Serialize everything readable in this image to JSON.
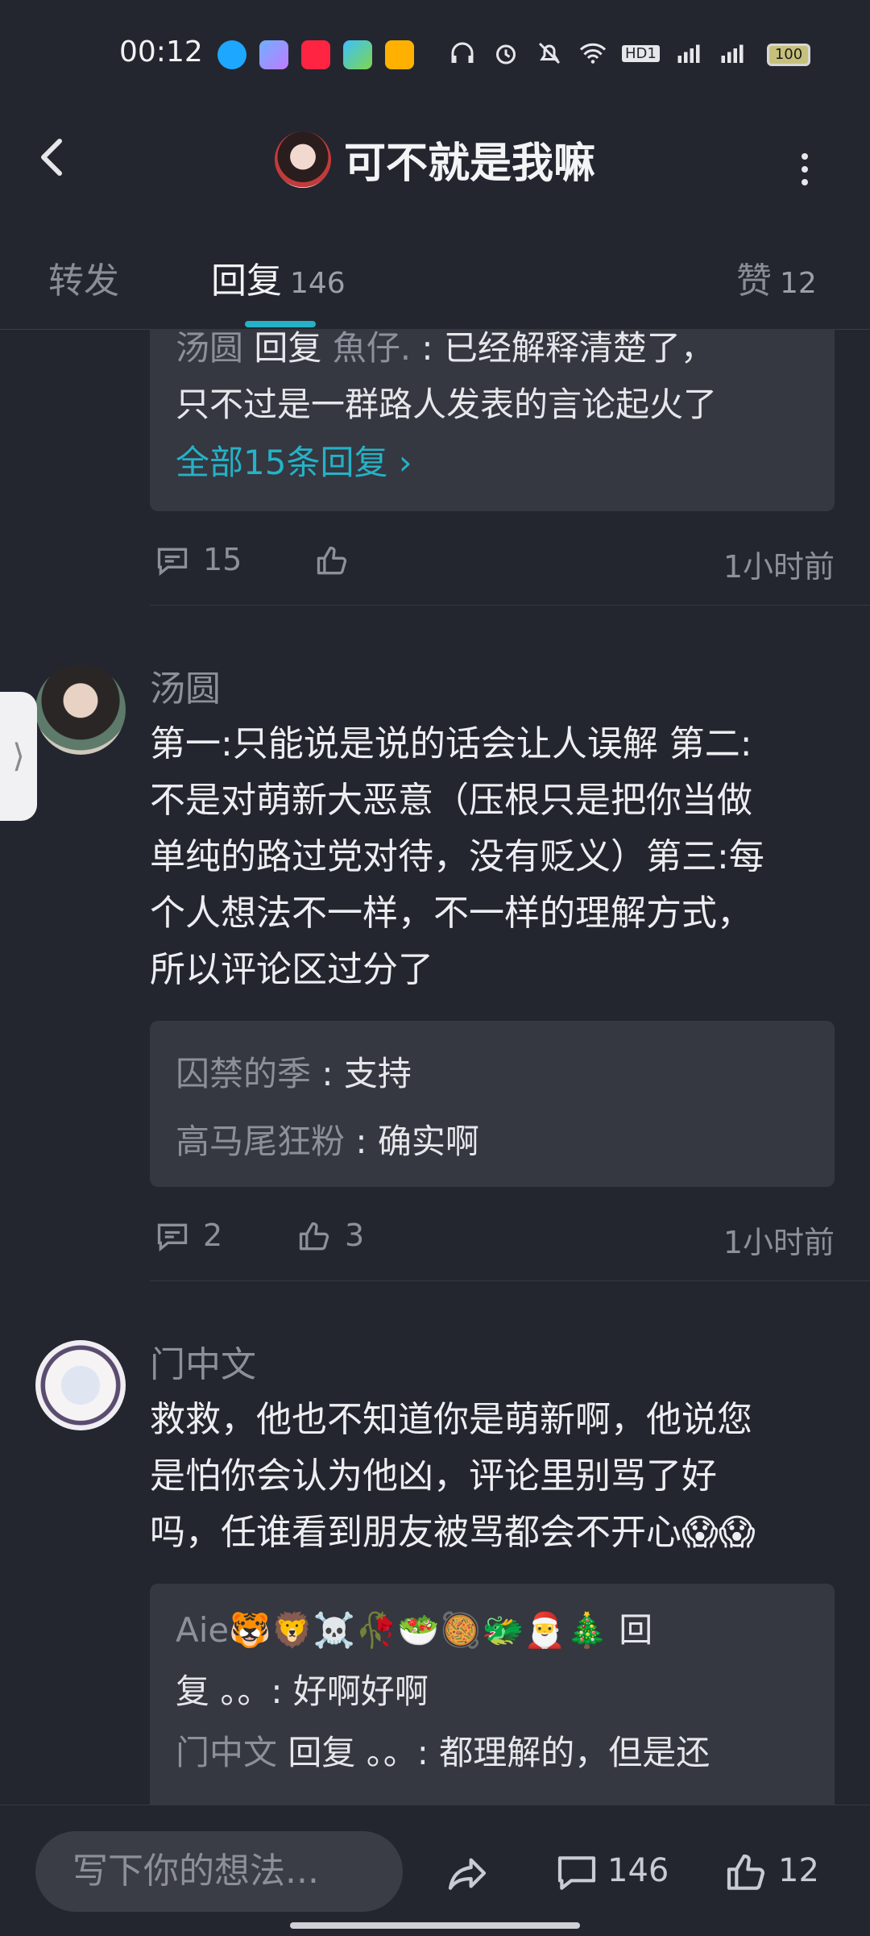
{
  "status": {
    "time": "00:12",
    "battery": "100",
    "network": [
      "HD1",
      "4G",
      "3G"
    ],
    "app_icons": [
      "qq-icon",
      "browser-icon",
      "xiaohongshu-icon",
      "video-icon",
      "weibo-icon"
    ]
  },
  "header": {
    "title": "可不就是我嘛"
  },
  "tabs": {
    "forward": "转发",
    "reply": "回复",
    "reply_count": "146",
    "like": "赞",
    "like_count": "12"
  },
  "side_tab": "⟩",
  "comments": [
    {
      "replies": [
        {
          "who": "汤圆",
          "verb": " 回复 ",
          "target": "魚仔.",
          "text": " : 已经解释清楚了，"
        },
        {
          "text": "只不过是一群路人发表的言论起火了"
        }
      ],
      "all_replies": "全部15条回复 ›",
      "reply_count": "15",
      "like_count": "",
      "time": "1小时前"
    },
    {
      "author": "汤圆",
      "lines": [
        "第一:只能说是说的话会让人误解 第二:",
        "不是对萌新大恶意（压根只是把你当做",
        "单纯的路过党对待，没有贬义）第三:每",
        "个人想法不一样，不一样的理解方式，",
        "所以评论区过分了"
      ],
      "replies": [
        {
          "who": "囚禁的季",
          "text": " : 支持"
        },
        {
          "who": "高马尾狂粉",
          "text": " : 确实啊"
        }
      ],
      "reply_count": "2",
      "like_count": "3",
      "time": "1小时前"
    },
    {
      "author": "门中文",
      "lines": [
        "救救，他也不知道你是萌新啊，他说您",
        "是怕你会认为他凶，评论里别骂了好",
        "吗，任谁看到朋友被骂都会不开心😱😱"
      ],
      "replies": [
        {
          "who": "Aie🐯🦁☠️🥀🥗🥘🐲🎅🎄",
          "verb": " 回"
        },
        {
          "text": "复 。。: 好啊好啊"
        },
        {
          "who": "门中文",
          "verb": " 回复 ",
          "text": "。。: 都理解的，但是还"
        }
      ]
    }
  ],
  "bottom": {
    "input_placeholder": "写下你的想法...",
    "comment_count": "146",
    "like_count": "12"
  }
}
